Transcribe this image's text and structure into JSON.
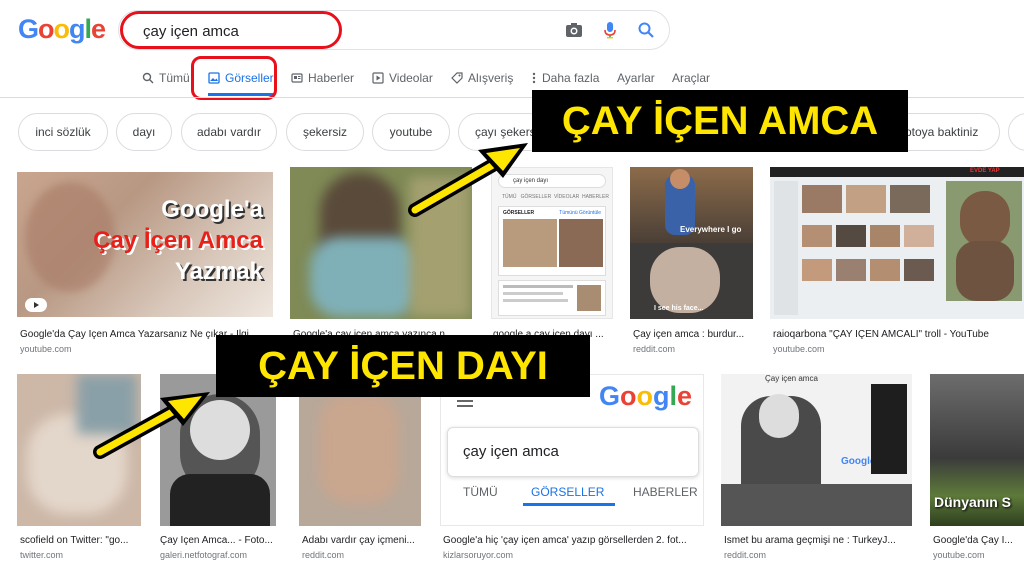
{
  "header": {
    "logo": "Google",
    "search_value": "çay içen amca",
    "icons": [
      "camera-icon",
      "mic-icon",
      "search-icon"
    ]
  },
  "tabs": [
    {
      "label": "Tümü",
      "icon": "search-icon"
    },
    {
      "label": "Görseller",
      "icon": "image-icon",
      "active": true
    },
    {
      "label": "Haberler",
      "icon": "news-icon"
    },
    {
      "label": "Videolar",
      "icon": "play-icon"
    },
    {
      "label": "Alışveriş",
      "icon": "tag-icon"
    },
    {
      "label": "Daha fazla",
      "icon": "more-icon"
    },
    {
      "label": "Ayarlar"
    },
    {
      "label": "Araçlar"
    }
  ],
  "chips": [
    "inci sözlük",
    "dayı",
    "adabı vardır",
    "şekersiz",
    "youtube",
    "çayı şekersiz",
    "fotoya baktiniz"
  ],
  "banners": {
    "top": "ÇAY İÇEN AMCA",
    "bottom": "ÇAY İÇEN DAYI"
  },
  "thumb_texts": {
    "r1c1_line1": "Google'a",
    "r1c1_line2": "Çay İçen Amca",
    "r1c1_line3": "Yazmak",
    "r1c3_search": "çay içen dayı",
    "r1c3_tab": "GÖRSELLER",
    "r1c3_link": "Tümünü Görüntüle",
    "r1c4_caption1": "Everywhere I go",
    "r1c4_caption2": "I see his face...",
    "r1c5_label": "EVDE YAP",
    "r2c4_logo": "Google",
    "r2c4_query": "çay içen amca",
    "r2c4_tabs": [
      "TÜMÜ",
      "GÖRSELLER",
      "HABERLER"
    ],
    "r2c5_query": "Çay içen amca",
    "r2c5_logo": "Google",
    "r2c6_text": "Dünyanın S"
  },
  "results": [
    {
      "caption": "Google'da Çay İçen Amca Yazarsanız Ne çıkar - İlgi...",
      "source": "youtube.com"
    },
    {
      "caption": "Google'a çay içen amca yazınca ne...",
      "source": ""
    },
    {
      "caption": "google a çay içen dayı ...",
      "source": ""
    },
    {
      "caption": "Çay içen amca : burdur...",
      "source": "reddit.com"
    },
    {
      "caption": "raioqarbona \"ÇAY İÇEN AMCALI\" troll - YouTube",
      "source": "youtube.com"
    },
    {
      "caption": "scofield on Twitter: \"go...",
      "source": "twitter.com"
    },
    {
      "caption": "Çay İçen Amca... - Foto...",
      "source": "galeri.netfotograf.com"
    },
    {
      "caption": "Adabı vardır çay içmeni...",
      "source": "reddit.com"
    },
    {
      "caption": "Google'a hiç 'çay içen amca' yazıp görsellerden 2. fot...",
      "source": "kizlarsoruyor.com"
    },
    {
      "caption": "İsmet bu arama geçmişi ne : TurkeyJ...",
      "source": "reddit.com"
    },
    {
      "caption": "Google'da Çay İ...",
      "source": "youtube.com"
    }
  ]
}
